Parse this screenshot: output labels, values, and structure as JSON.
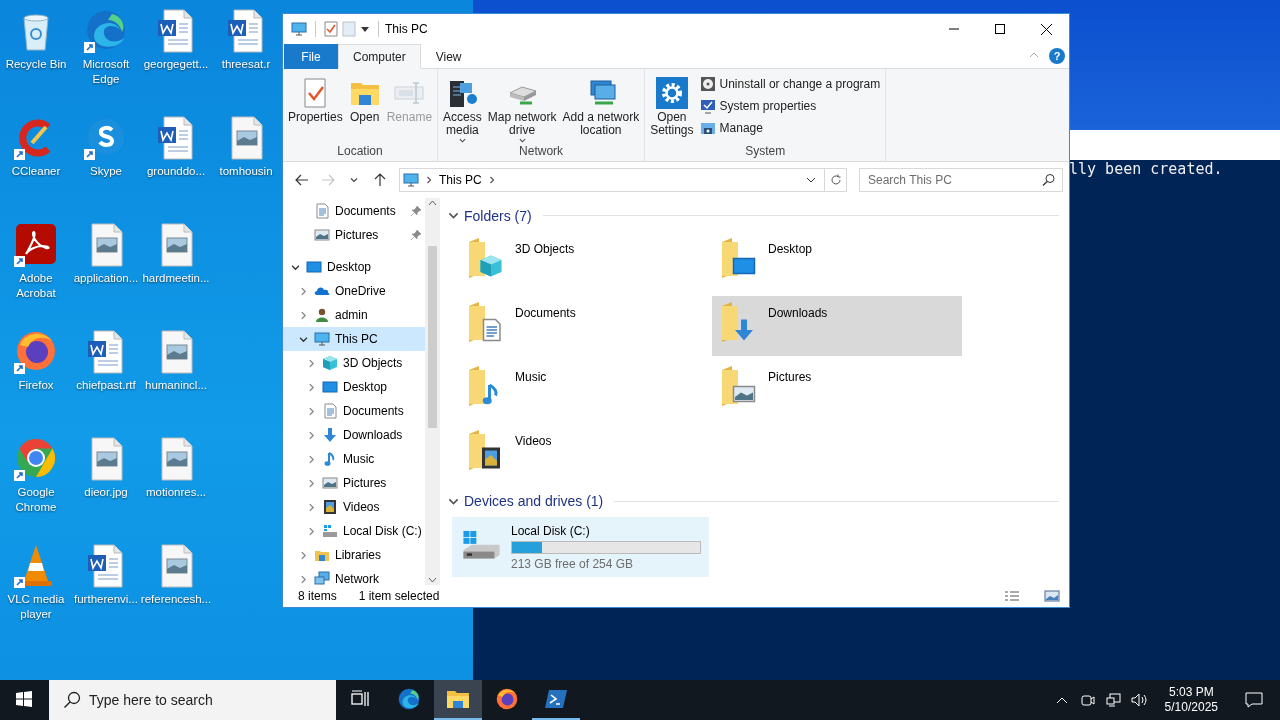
{
  "desktop_icons": [
    {
      "label": "Recycle Bin",
      "kind": "recycle-bin",
      "shortcut": false
    },
    {
      "label": "CCleaner",
      "kind": "ccleaner",
      "shortcut": true
    },
    {
      "label": "Adobe Acrobat",
      "kind": "acrobat",
      "shortcut": true
    },
    {
      "label": "Firefox",
      "kind": "firefox",
      "shortcut": true
    },
    {
      "label": "Google Chrome",
      "kind": "chrome",
      "shortcut": true
    },
    {
      "label": "VLC media player",
      "kind": "vlc",
      "shortcut": true
    },
    {
      "label": "Microsoft Edge",
      "kind": "edge",
      "shortcut": true
    },
    {
      "label": "Skype",
      "kind": "skype",
      "shortcut": true
    },
    {
      "label": "application...",
      "kind": "image-file",
      "shortcut": false
    },
    {
      "label": "chiefpast.rtf",
      "kind": "word-doc",
      "shortcut": false
    },
    {
      "label": "dieor.jpg",
      "kind": "image-file",
      "shortcut": false
    },
    {
      "label": "furtherenvi...",
      "kind": "word-doc",
      "shortcut": false
    },
    {
      "label": "georgegett...",
      "kind": "word-doc",
      "shortcut": false
    },
    {
      "label": "grounddo...",
      "kind": "word-doc",
      "shortcut": false
    },
    {
      "label": "hardmeetin...",
      "kind": "image-file",
      "shortcut": false
    },
    {
      "label": "humanincl...",
      "kind": "image-file",
      "shortcut": false
    },
    {
      "label": "motionres...",
      "kind": "image-file",
      "shortcut": false
    },
    {
      "label": "referencesh...",
      "kind": "image-file",
      "shortcut": false
    },
    {
      "label": "threesat.r",
      "kind": "word-doc",
      "shortcut": false
    },
    {
      "label": "tomhousin",
      "kind": "image-file",
      "shortcut": false
    }
  ],
  "console": {
    "text": "lly been created."
  },
  "explorer": {
    "title": "This PC",
    "ribbon_tabs": [
      {
        "label": "File",
        "kind": "file",
        "selected": false
      },
      {
        "label": "Computer",
        "kind": "tab",
        "selected": true
      },
      {
        "label": "View",
        "kind": "tab",
        "selected": false
      }
    ],
    "help": "?",
    "ribbon_groups": [
      {
        "label": "Location",
        "commands": [
          {
            "label": "Properties",
            "kind": "large",
            "disabled": false,
            "dropdown": false
          },
          {
            "label": "Open",
            "kind": "large",
            "disabled": false,
            "dropdown": false
          },
          {
            "label": "Rename",
            "kind": "large",
            "disabled": true,
            "dropdown": false
          }
        ]
      },
      {
        "label": "Network",
        "commands": [
          {
            "label": "Access\nmedia",
            "kind": "large",
            "disabled": false,
            "dropdown": true
          },
          {
            "label": "Map network\ndrive",
            "kind": "large",
            "disabled": false,
            "dropdown": true
          },
          {
            "label": "Add a network\nlocation",
            "kind": "large",
            "disabled": false,
            "dropdown": false
          }
        ]
      },
      {
        "label": "System",
        "commands": [
          {
            "label": "Open\nSettings",
            "kind": "large",
            "disabled": false,
            "dropdown": false
          },
          {
            "label": "Uninstall or change a program",
            "kind": "small",
            "disabled": false,
            "dropdown": false
          },
          {
            "label": "System properties",
            "kind": "small",
            "disabled": false,
            "dropdown": false
          },
          {
            "label": "Manage",
            "kind": "small",
            "disabled": false,
            "dropdown": false
          }
        ]
      }
    ],
    "address": {
      "path": "This PC",
      "search_placeholder": "Search This PC"
    },
    "quick_access": [
      {
        "label": "Documents",
        "kind": "doc",
        "pinned": true
      },
      {
        "label": "Pictures",
        "kind": "pictures",
        "pinned": true
      }
    ],
    "tree": [
      {
        "label": "Desktop",
        "kind": "desktop",
        "expanded": true,
        "selected": false,
        "children": [
          {
            "label": "OneDrive",
            "kind": "onedrive",
            "expanded": false,
            "selected": false
          },
          {
            "label": "admin",
            "kind": "user",
            "expanded": false,
            "selected": false
          },
          {
            "label": "This PC",
            "kind": "pc",
            "expanded": true,
            "selected": true,
            "children": [
              {
                "label": "3D Objects",
                "kind": "cube",
                "expanded": false,
                "selected": false
              },
              {
                "label": "Desktop",
                "kind": "desktop",
                "expanded": false,
                "selected": false
              },
              {
                "label": "Documents",
                "kind": "doc",
                "expanded": false,
                "selected": false
              },
              {
                "label": "Downloads",
                "kind": "download",
                "expanded": false,
                "selected": false
              },
              {
                "label": "Music",
                "kind": "music",
                "expanded": false,
                "selected": false
              },
              {
                "label": "Pictures",
                "kind": "pictures",
                "expanded": false,
                "selected": false
              },
              {
                "label": "Videos",
                "kind": "video",
                "expanded": false,
                "selected": false
              },
              {
                "label": "Local Disk (C:)",
                "kind": "disk",
                "expanded": false,
                "selected": false
              }
            ]
          },
          {
            "label": "Libraries",
            "kind": "libraries",
            "expanded": false,
            "selected": false
          },
          {
            "label": "Network",
            "kind": "network",
            "expanded": false,
            "selected": false
          }
        ]
      }
    ],
    "sections": [
      {
        "title": "Folders (7)",
        "kind": "folders",
        "expanded": true,
        "items": [
          {
            "label": "3D Objects",
            "kind": "cube",
            "selected": false
          },
          {
            "label": "Desktop",
            "kind": "desktop",
            "selected": false
          },
          {
            "label": "Documents",
            "kind": "doc",
            "selected": false
          },
          {
            "label": "Downloads",
            "kind": "download",
            "selected": true
          },
          {
            "label": "Music",
            "kind": "music",
            "selected": false
          },
          {
            "label": "Pictures",
            "kind": "pictures",
            "selected": false
          },
          {
            "label": "Videos",
            "kind": "video",
            "selected": false
          }
        ]
      },
      {
        "title": "Devices and drives (1)",
        "kind": "drives",
        "expanded": true,
        "items": [
          {
            "label": "Local Disk (C:)",
            "free": "213 GB free of 254 GB",
            "level": 0.16,
            "highlighted": true
          }
        ]
      }
    ],
    "status": {
      "count": "8 items",
      "selection": "1 item selected"
    }
  },
  "taskbar": {
    "search_placeholder": "Type here to search",
    "apps": [
      {
        "kind": "task-view",
        "active": false,
        "running": false
      },
      {
        "kind": "edge",
        "active": false,
        "running": false
      },
      {
        "kind": "explorer",
        "active": true,
        "running": true
      },
      {
        "kind": "firefox",
        "active": false,
        "running": false
      },
      {
        "kind": "powershell",
        "active": false,
        "running": true
      }
    ],
    "time": "5:03 PM",
    "date": "5/10/2025"
  }
}
